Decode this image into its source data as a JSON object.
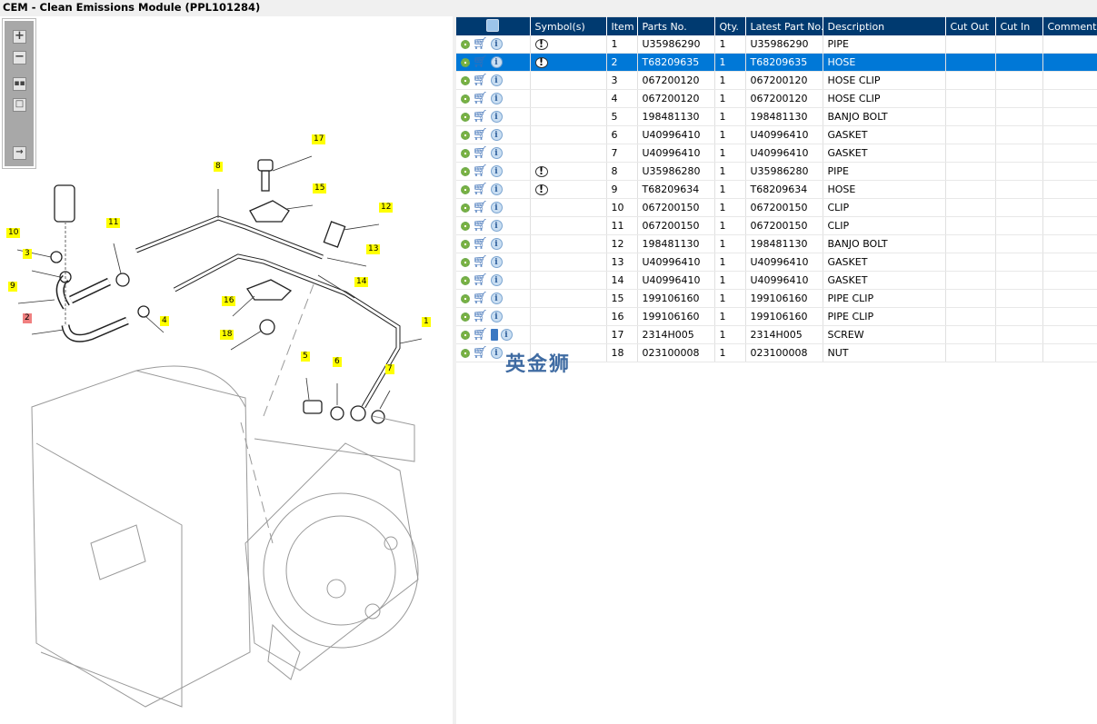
{
  "title": "CEM - Clean Emissions Module (PPL101284)",
  "toolbar": {
    "icons": [
      "zoom-in-icon",
      "zoom-out-icon",
      "fit-icon",
      "actual-size-icon",
      "export-icon"
    ]
  },
  "callouts": [
    {
      "label": "17"
    },
    {
      "label": "8"
    },
    {
      "label": "15"
    },
    {
      "label": "12"
    },
    {
      "label": "11"
    },
    {
      "label": "13"
    },
    {
      "label": "10"
    },
    {
      "label": "3"
    },
    {
      "label": "14"
    },
    {
      "label": "9"
    },
    {
      "label": "16"
    },
    {
      "label": "2",
      "highlight": true
    },
    {
      "label": "4"
    },
    {
      "label": "1"
    },
    {
      "label": "18"
    },
    {
      "label": "5"
    },
    {
      "label": "6"
    },
    {
      "label": "7"
    }
  ],
  "table": {
    "headers": [
      "",
      "Symbol(s)",
      "Item",
      "Parts No.",
      "Qty.",
      "Latest Part No.",
      "Description",
      "Cut Out",
      "Cut In",
      "Comment"
    ],
    "selected_row": 1,
    "rows": [
      {
        "symbol": true,
        "item": "1",
        "part": "U35986290",
        "qty": "1",
        "latest": "U35986290",
        "desc": "PIPE"
      },
      {
        "symbol": true,
        "item": "2",
        "part": "T68209635",
        "qty": "1",
        "latest": "T68209635",
        "desc": "HOSE"
      },
      {
        "symbol": false,
        "item": "3",
        "part": "067200120",
        "qty": "1",
        "latest": "067200120",
        "desc": "HOSE CLIP"
      },
      {
        "symbol": false,
        "item": "4",
        "part": "067200120",
        "qty": "1",
        "latest": "067200120",
        "desc": "HOSE CLIP"
      },
      {
        "symbol": false,
        "item": "5",
        "part": "198481130",
        "qty": "1",
        "latest": "198481130",
        "desc": "BANJO BOLT"
      },
      {
        "symbol": false,
        "item": "6",
        "part": "U40996410",
        "qty": "1",
        "latest": "U40996410",
        "desc": "GASKET"
      },
      {
        "symbol": false,
        "item": "7",
        "part": "U40996410",
        "qty": "1",
        "latest": "U40996410",
        "desc": "GASKET"
      },
      {
        "symbol": true,
        "item": "8",
        "part": "U35986280",
        "qty": "1",
        "latest": "U35986280",
        "desc": "PIPE"
      },
      {
        "symbol": true,
        "item": "9",
        "part": "T68209634",
        "qty": "1",
        "latest": "T68209634",
        "desc": "HOSE"
      },
      {
        "symbol": false,
        "item": "10",
        "part": "067200150",
        "qty": "1",
        "latest": "067200150",
        "desc": "CLIP"
      },
      {
        "symbol": false,
        "item": "11",
        "part": "067200150",
        "qty": "1",
        "latest": "067200150",
        "desc": "CLIP"
      },
      {
        "symbol": false,
        "item": "12",
        "part": "198481130",
        "qty": "1",
        "latest": "198481130",
        "desc": "BANJO BOLT"
      },
      {
        "symbol": false,
        "item": "13",
        "part": "U40996410",
        "qty": "1",
        "latest": "U40996410",
        "desc": "GASKET"
      },
      {
        "symbol": false,
        "item": "14",
        "part": "U40996410",
        "qty": "1",
        "latest": "U40996410",
        "desc": "GASKET"
      },
      {
        "symbol": false,
        "item": "15",
        "part": "199106160",
        "qty": "1",
        "latest": "199106160",
        "desc": "PIPE CLIP"
      },
      {
        "symbol": false,
        "item": "16",
        "part": "199106160",
        "qty": "1",
        "latest": "199106160",
        "desc": "PIPE CLIP"
      },
      {
        "symbol": false,
        "item": "17",
        "part": "2314H005",
        "qty": "1",
        "latest": "2314H005",
        "desc": "SCREW",
        "book": true
      },
      {
        "symbol": false,
        "item": "18",
        "part": "023100008",
        "qty": "1",
        "latest": "023100008",
        "desc": "NUT"
      }
    ]
  },
  "watermark": "英金狮",
  "colors": {
    "header": "#003a70",
    "selected": "#0078d7",
    "callout": "#ffff00",
    "callout_highlight": "#f08080"
  }
}
